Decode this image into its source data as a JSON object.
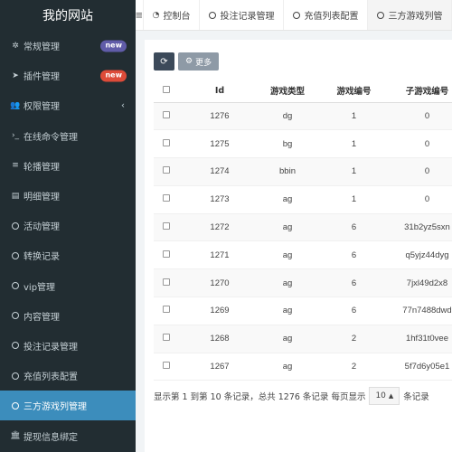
{
  "brand": "我的网站",
  "sidebar": {
    "items": [
      {
        "label": "常规管理",
        "icon": "cogs-icon",
        "badge": "new",
        "badge_color": "#605ca8"
      },
      {
        "label": "插件管理",
        "icon": "rocket-icon",
        "badge": "new",
        "badge_color": "#dd4b39"
      },
      {
        "label": "权限管理",
        "icon": "users-icon",
        "chevron": "‹"
      },
      {
        "label": "在线命令管理",
        "icon": "terminal-icon"
      },
      {
        "label": "轮播管理",
        "icon": "list-icon"
      },
      {
        "label": "明细管理",
        "icon": "calendar-icon"
      },
      {
        "label": "活动管理",
        "icon": "circle-o-icon"
      },
      {
        "label": "转换记录",
        "icon": "circle-o-icon"
      },
      {
        "label": "vip管理",
        "icon": "circle-o-icon"
      },
      {
        "label": "内容管理",
        "icon": "circle-o-icon"
      },
      {
        "label": "投注记录管理",
        "icon": "circle-o-icon"
      },
      {
        "label": "充值列表配置",
        "icon": "circle-o-icon"
      },
      {
        "label": "三方游戏列管理",
        "icon": "circle-o-icon",
        "active": true
      },
      {
        "label": "提现信息绑定",
        "icon": "bank-icon"
      }
    ]
  },
  "tabs": [
    {
      "label": "控制台",
      "icon": "dashboard-icon"
    },
    {
      "label": "投注记录管理",
      "icon": "circle-o-icon"
    },
    {
      "label": "充值列表配置",
      "icon": "circle-o-icon"
    },
    {
      "label": "三方游戏列管",
      "icon": "circle-o-icon",
      "active": true
    }
  ],
  "toolbar": {
    "refresh_icon": "refresh-icon",
    "more_label": "更多"
  },
  "table": {
    "headers": [
      "Id",
      "游戏类型",
      "游戏编号",
      "子游戏编号"
    ],
    "rows": [
      [
        "1276",
        "dg",
        "1",
        "0"
      ],
      [
        "1275",
        "bg",
        "1",
        "0"
      ],
      [
        "1274",
        "bbin",
        "1",
        "0"
      ],
      [
        "1273",
        "ag",
        "1",
        "0"
      ],
      [
        "1272",
        "ag",
        "6",
        "31b2yz5sxn"
      ],
      [
        "1271",
        "ag",
        "6",
        "q5yjz44dyg"
      ],
      [
        "1270",
        "ag",
        "6",
        "7jxl49d2x8"
      ],
      [
        "1269",
        "ag",
        "6",
        "77n7488dwd"
      ],
      [
        "1268",
        "ag",
        "2",
        "1hf31t0vee"
      ],
      [
        "1267",
        "ag",
        "2",
        "5f7d6y05e1"
      ]
    ]
  },
  "pager": {
    "summary": "显示第 1 到第 10 条记录，总共 1276 条记录 每页显示",
    "page_size": "10",
    "suffix": "条记录"
  },
  "colors": {
    "sidebar_bg": "#222d32",
    "active_item": "#3c8dbc",
    "accent_dark": "#3c4a5a"
  }
}
